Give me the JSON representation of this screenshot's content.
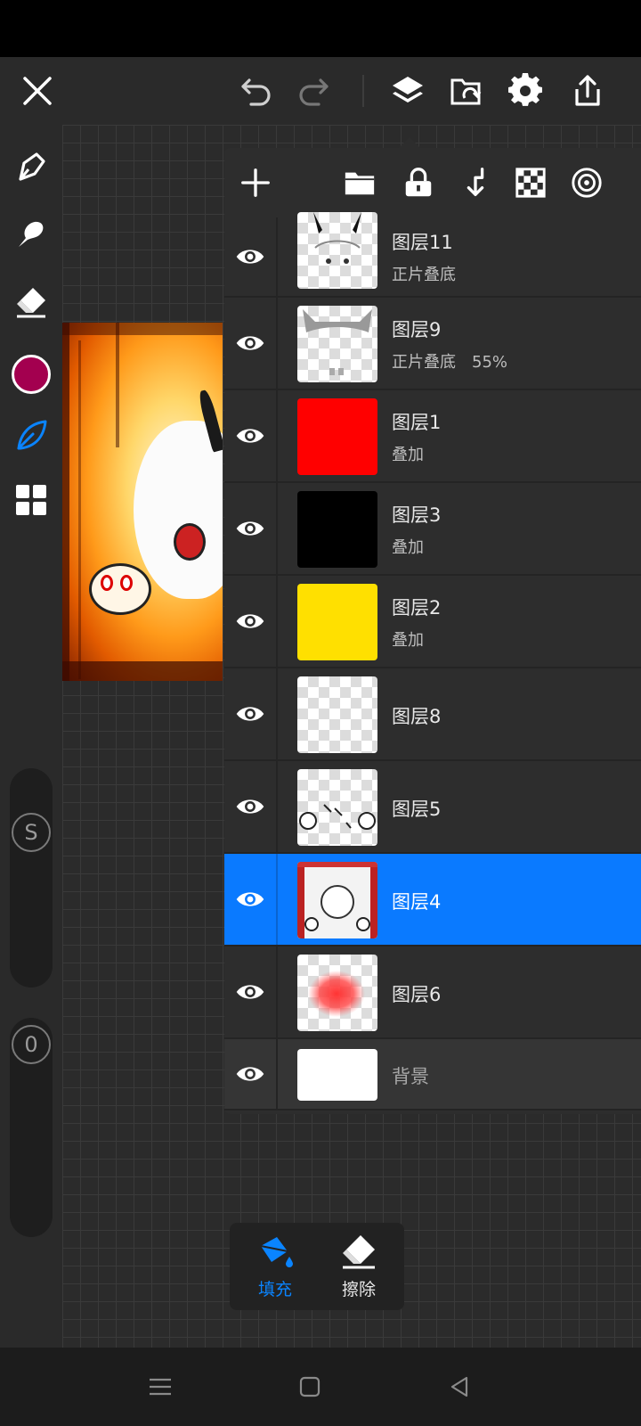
{
  "toolbar": {
    "close_icon": "close-icon",
    "undo_icon": "undo-icon",
    "redo_icon": "redo-icon",
    "layers_icon": "layers-icon",
    "gallery_icon": "gallery-icon",
    "settings_icon": "gear-icon",
    "share_icon": "share-icon"
  },
  "left_tools": {
    "brush_icon": "pen-icon",
    "smudge_icon": "smudge-icon",
    "eraser_icon": "eraser-icon",
    "current_color": "#a3004f",
    "fill_tool_icon": "leaf-icon",
    "more_icon": "grid-icon",
    "size_knob": "S",
    "opacity_knob": "0"
  },
  "layer_panel": {
    "add_icon": "plus-icon",
    "folder_icon": "folder-icon",
    "lock_icon": "lock-icon",
    "merge_down_icon": "merge-down-icon",
    "transparency_icon": "checker-icon",
    "blend_icon": "target-icon",
    "layers": [
      {
        "name": "图层11",
        "mode": "正片叠底",
        "opacity": "",
        "selected": false,
        "thumb": "art-horns"
      },
      {
        "name": "图层9",
        "mode": "正片叠底",
        "opacity": "55%",
        "selected": false,
        "thumb": "art-gray"
      },
      {
        "name": "图层1",
        "mode": "叠加",
        "opacity": "",
        "selected": false,
        "thumb": "#ff0000"
      },
      {
        "name": "图层3",
        "mode": "叠加",
        "opacity": "",
        "selected": false,
        "thumb": "#000000"
      },
      {
        "name": "图层2",
        "mode": "叠加",
        "opacity": "",
        "selected": false,
        "thumb": "#ffe000"
      },
      {
        "name": "图层8",
        "mode": "",
        "opacity": "",
        "selected": false,
        "thumb": "transparent"
      },
      {
        "name": "图层5",
        "mode": "",
        "opacity": "",
        "selected": false,
        "thumb": "art-skulls"
      },
      {
        "name": "图层4",
        "mode": "",
        "opacity": "",
        "selected": true,
        "thumb": "art-full"
      },
      {
        "name": "图层6",
        "mode": "",
        "opacity": "",
        "selected": false,
        "thumb": "art-redblob"
      }
    ],
    "background_layer": {
      "name": "背景"
    }
  },
  "bottom_actions": {
    "fill_label": "填充",
    "erase_label": "擦除"
  },
  "colors": {
    "accent": "#0a7aff",
    "toolbar_bg": "#2a2a2a",
    "panel_bg": "#2d2d2d"
  }
}
